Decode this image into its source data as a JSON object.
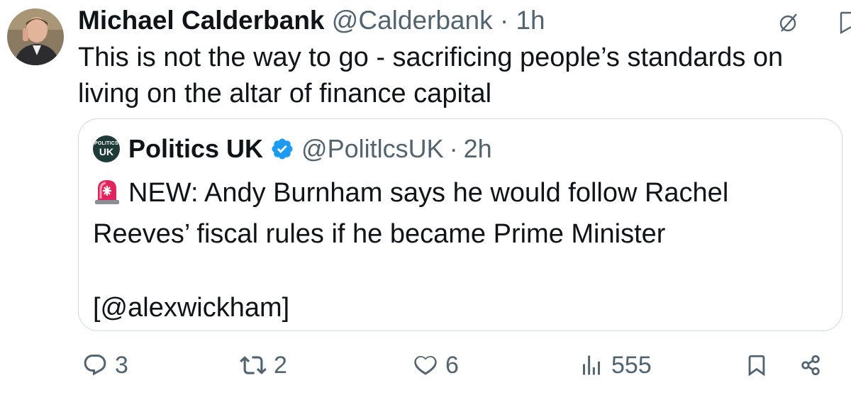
{
  "tweet": {
    "author_name": "Michael Calderbank",
    "handle": "@Calderbank",
    "separator": "·",
    "time": "1h",
    "text": "This is not the way to go - sacrificing people’s standards on living on the altar of finance capital"
  },
  "quote": {
    "logo_line1": "POLITICS",
    "logo_line2": "UK",
    "name": "Politics UK",
    "handle": "@PolitlcsUK",
    "separator": "·",
    "time": "2h",
    "line1": "NEW: Andy Burnham says he would follow Rachel",
    "line2": "Reeves’ fiscal rules if he became Prime Minister",
    "line3": "[@alexwickham]"
  },
  "actions": {
    "replies": "3",
    "reposts": "2",
    "likes": "6",
    "views": "555"
  },
  "colors": {
    "text": "#0f1419",
    "secondary": "#536471",
    "border": "#cfd9de",
    "verified": "#1d9bf0",
    "alert": "#e0245e"
  }
}
